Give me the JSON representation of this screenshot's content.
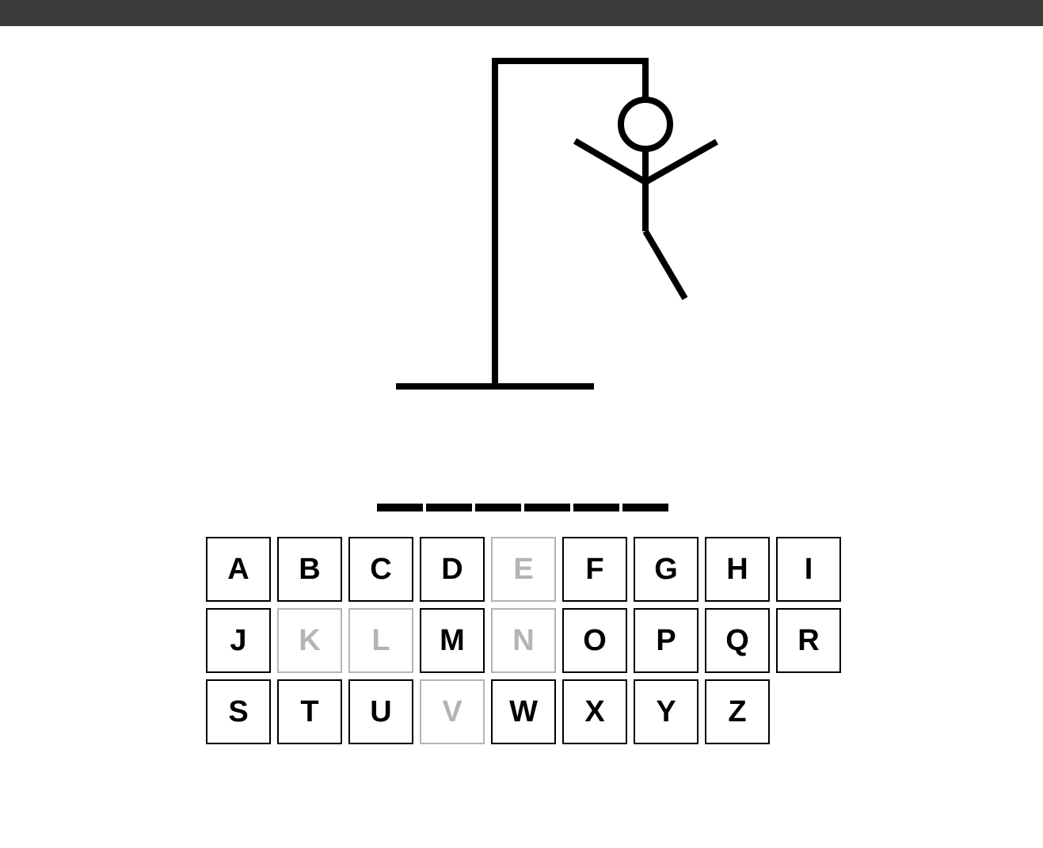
{
  "game": {
    "word_length": 6,
    "wrong_guesses": 5
  },
  "keyboard": {
    "rows": [
      [
        {
          "letter": "A",
          "used": false
        },
        {
          "letter": "B",
          "used": false
        },
        {
          "letter": "C",
          "used": false
        },
        {
          "letter": "D",
          "used": false
        },
        {
          "letter": "E",
          "used": true
        },
        {
          "letter": "F",
          "used": false
        },
        {
          "letter": "G",
          "used": false
        },
        {
          "letter": "H",
          "used": false
        },
        {
          "letter": "I",
          "used": false
        }
      ],
      [
        {
          "letter": "J",
          "used": false
        },
        {
          "letter": "K",
          "used": true
        },
        {
          "letter": "L",
          "used": true
        },
        {
          "letter": "M",
          "used": false
        },
        {
          "letter": "N",
          "used": true
        },
        {
          "letter": "O",
          "used": false
        },
        {
          "letter": "P",
          "used": false
        },
        {
          "letter": "Q",
          "used": false
        },
        {
          "letter": "R",
          "used": false
        }
      ],
      [
        {
          "letter": "S",
          "used": false
        },
        {
          "letter": "T",
          "used": false
        },
        {
          "letter": "U",
          "used": false
        },
        {
          "letter": "V",
          "used": true
        },
        {
          "letter": "W",
          "used": false
        },
        {
          "letter": "X",
          "used": false
        },
        {
          "letter": "Y",
          "used": false
        },
        {
          "letter": "Z",
          "used": false
        }
      ]
    ]
  },
  "colors": {
    "top_bar": "#3c3c3c",
    "ink": "#000000",
    "used_key": "#b4b4b4"
  }
}
